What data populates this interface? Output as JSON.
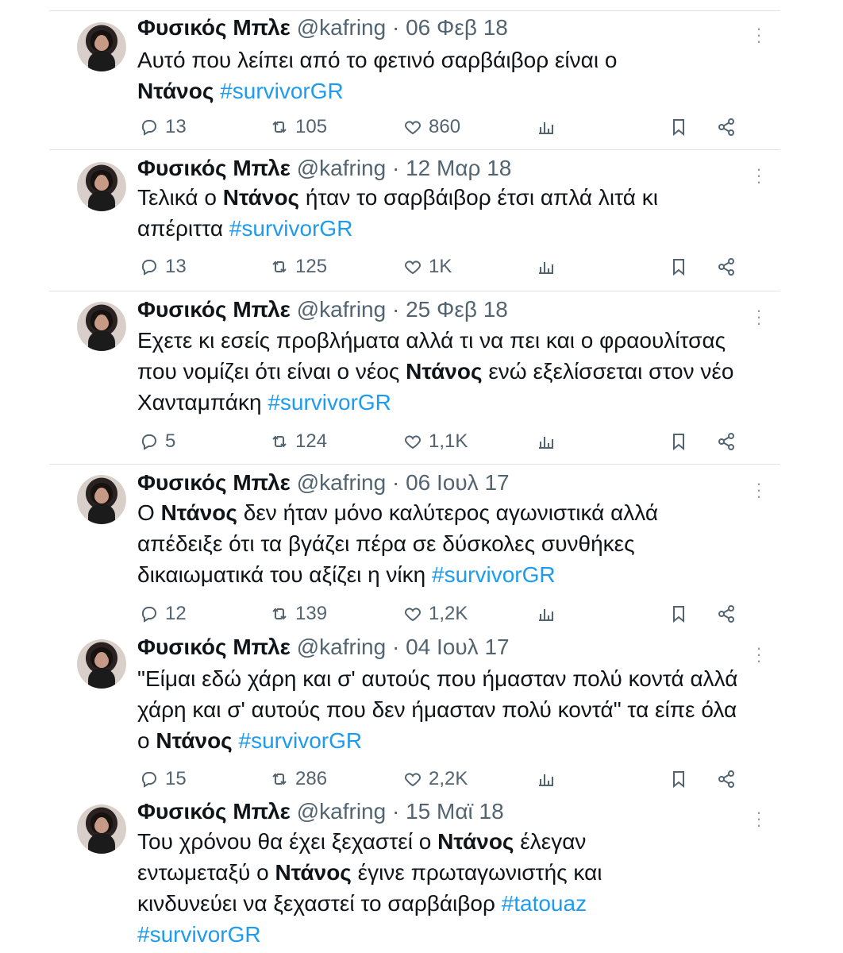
{
  "tweets": [
    {
      "name": "Φυσικός Μπλε",
      "handle": "@kafring",
      "sep": "·",
      "date": "06 Φεβ 18",
      "text": [
        {
          "t": "Αυτό που λείπει από το φετινό σαρβάιβορ είναι ο "
        },
        {
          "t": "Ντάνος",
          "b": true
        },
        {
          "t": " "
        },
        {
          "t": "#survivorGR",
          "tag": true
        }
      ],
      "replies": "13",
      "retweets": "105",
      "likes": "860"
    },
    {
      "name": "Φυσικός Μπλε",
      "handle": "@kafring",
      "sep": "·",
      "date": "12 Μαρ 18",
      "text": [
        {
          "t": "Τελικά ο "
        },
        {
          "t": "Ντάνος",
          "b": true
        },
        {
          "t": " ήταν το σαρβάιβορ έτσι απλά λιτά κι απέριττα "
        },
        {
          "t": "#survivorGR",
          "tag": true
        }
      ],
      "replies": "13",
      "retweets": "125",
      "likes": "1K"
    },
    {
      "name": "Φυσικός Μπλε",
      "handle": "@kafring",
      "sep": "·",
      "date": "25 Φεβ 18",
      "text": [
        {
          "t": "Εχετε κι εσείς προβλήματα αλλά τι να πει και ο φραουλίτσας που νομίζει ότι είναι ο νέος "
        },
        {
          "t": "Ντάνος",
          "b": true
        },
        {
          "t": " ενώ εξελίσσεται στον νέο Χανταμπάκη "
        },
        {
          "t": "#survivorGR",
          "tag": true
        }
      ],
      "replies": "5",
      "retweets": "124",
      "likes": "1,1K"
    },
    {
      "name": "Φυσικός Μπλε",
      "handle": "@kafring",
      "sep": "·",
      "date": "06 Ιουλ 17",
      "text": [
        {
          "t": "Ο "
        },
        {
          "t": "Ντάνος",
          "b": true
        },
        {
          "t": " δεν ήταν μόνο καλύτερος αγωνιστικά αλλά απέδειξε ότι τα βγάζει πέρα σε δύσκολες συνθήκες δικαιωματικά του αξίζει η νίκη "
        },
        {
          "t": "#survivorGR",
          "tag": true
        }
      ],
      "replies": "12",
      "retweets": "139",
      "likes": "1,2K"
    },
    {
      "name": "Φυσικός Μπλε",
      "handle": "@kafring",
      "sep": "·",
      "date": "04 Ιουλ 17",
      "text": [
        {
          "t": "\"Είμαι εδώ χάρη και σ' αυτούς που ήμασταν πολύ κοντά αλλά χάρη και σ' αυτούς που δεν ήμασταν πολύ κοντά\" τα είπε όλα ο "
        },
        {
          "t": "Ντάνος",
          "b": true
        },
        {
          "t": " "
        },
        {
          "t": "#survivorGR",
          "tag": true
        }
      ],
      "replies": "15",
      "retweets": "286",
      "likes": "2,2K"
    },
    {
      "name": "Φυσικός Μπλε",
      "handle": "@kafring",
      "sep": "·",
      "date": "15 Μαϊ 18",
      "text": [
        {
          "t": "Του χρόνου θα έχει ξεχαστεί ο "
        },
        {
          "t": "Ντάνος",
          "b": true
        },
        {
          "t": " έλεγαν εντωμεταξύ ο "
        },
        {
          "t": "Ντάνος",
          "b": true
        },
        {
          "t": " έγινε πρωταγωνιστής και κινδυνεύει να ξεχαστεί το σαρβάιβορ "
        },
        {
          "t": "#tatouaz",
          "tag": true
        },
        {
          "t": " "
        },
        {
          "t": "#survivorGR",
          "tag": true
        }
      ],
      "replies": null,
      "retweets": null,
      "likes": null
    }
  ],
  "icons": {
    "reply": "reply-icon",
    "retweet": "retweet-icon",
    "like": "heart-icon",
    "views": "analytics-icon",
    "bookmark": "bookmark-icon",
    "share": "share-icon",
    "more": "more-vertical-icon"
  },
  "colors": {
    "hashtag": "#1d9bf0",
    "secondary": "#536471",
    "divider": "#dfe3e6"
  }
}
